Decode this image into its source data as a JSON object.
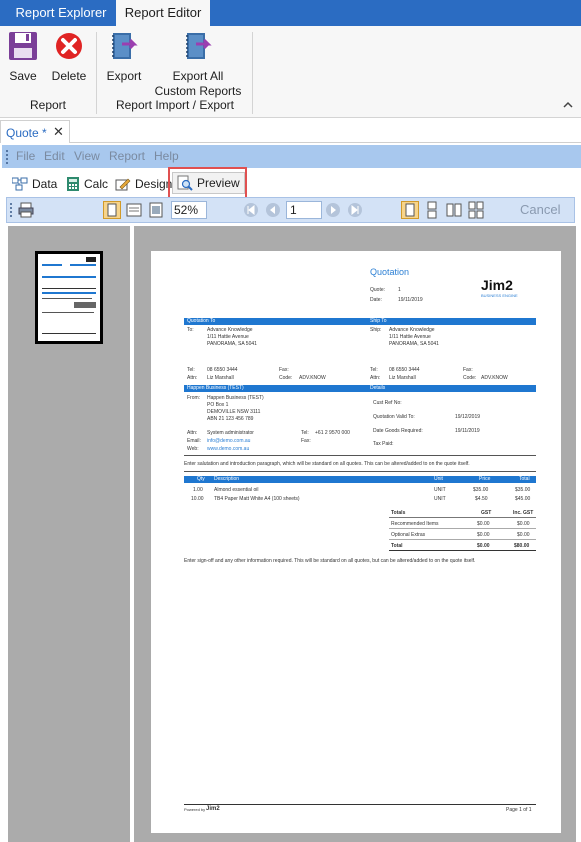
{
  "top_tabs": [
    "Report Explorer",
    "Report Editor"
  ],
  "ribbon": {
    "save": "Save",
    "delete": "Delete",
    "group_report": "Report",
    "export": "Export",
    "export_all": "Export All\nCustom Reports",
    "group_import_export": "Report Import / Export"
  },
  "doc_tab": "Quote *",
  "menu": [
    "File",
    "Edit",
    "View",
    "Report",
    "Help"
  ],
  "designer_tabs": [
    "Data",
    "Calc",
    "Design",
    "Preview"
  ],
  "preview_toolbar": {
    "zoom": "52%",
    "page": "1",
    "cancel": "Cancel"
  },
  "quote": {
    "title": "Quotation",
    "quote_label": "Quote:",
    "quote_no": "1",
    "date_label": "Date:",
    "date": "19/11/2019",
    "logo_text": "Jim2",
    "logo_sub": "BUSINESS ENGINE",
    "sec_quotation_to": "Quotation To",
    "sec_ship_to": "Ship To",
    "to_label": "To:",
    "ship_label": "Ship:",
    "addr1": "Advance Knowledge",
    "addr2": "1/11 Hattie Avenue",
    "addr3": "PANORAMA, SA 5041",
    "tel_label": "Tel:",
    "tel": "08 6550 3444",
    "fax_label": "Fax:",
    "attn_label": "Attn:",
    "attn": "Liz Marshall",
    "code_label": "Code:",
    "code": "ADV.KNOW",
    "sec_happen": "Happen Business (TEST)",
    "sec_details": "Details",
    "from_label": "From:",
    "from1": "Happen Business (TEST)",
    "from2": "PO Box 1",
    "from3": "DEMOVILLE NSW 3111",
    "from4": "ABN 21 123 456 789",
    "custref_label": "Cust Ref No:",
    "valid_label": "Quotation Valid To:",
    "valid": "19/12/2019",
    "reqdate_label": "Date Goods Required:",
    "reqdate": "19/11/2019",
    "taxpaid_label": "Tax Paid:",
    "from_attn_label": "Attn:",
    "from_attn": "System administrator",
    "from_tel_label": "Tel:",
    "from_tel": "+61 2 9570 000",
    "email_label": "Email:",
    "email": "info@demo.com.au",
    "fax2_label": "Fax:",
    "web_label": "Web:",
    "web": "www.demo.com.au",
    "intro": "Enter salutation and introduction paragraph, which will be standard on all quotes. This can be altered/added to on the quote itself.",
    "line_headers": [
      "Qty",
      "Description",
      "Unit",
      "Price",
      "Total"
    ],
    "lines": [
      {
        "qty": "1.00",
        "desc": "Almond essential oil",
        "unit": "UNIT",
        "price": "$35.00",
        "total": "$35.00"
      },
      {
        "qty": "10.00",
        "desc": "TB4 Paper Matt White A4 (100 sheets)",
        "unit": "UNIT",
        "price": "$4.50",
        "total": "$45.00"
      }
    ],
    "totals_label": "Totals",
    "gst_label": "GST",
    "incgst_label": "Inc. GST",
    "rec_items": "Recommended Items",
    "rec_gst": "$0.00",
    "rec_inc": "$0.00",
    "opt_extras": "Optional Extras",
    "opt_gst": "$0.00",
    "opt_inc": "$0.00",
    "total_label": "Total",
    "total_gst": "$0.00",
    "total_inc": "$80.00",
    "signoff": "Enter sign-off and any other information required. This will be standard on all quotes, but can be altered/added to on the quote itself.",
    "powered_by": "Powered by",
    "powered_logo": "Jim2",
    "page_of": "Page 1 of 1"
  }
}
